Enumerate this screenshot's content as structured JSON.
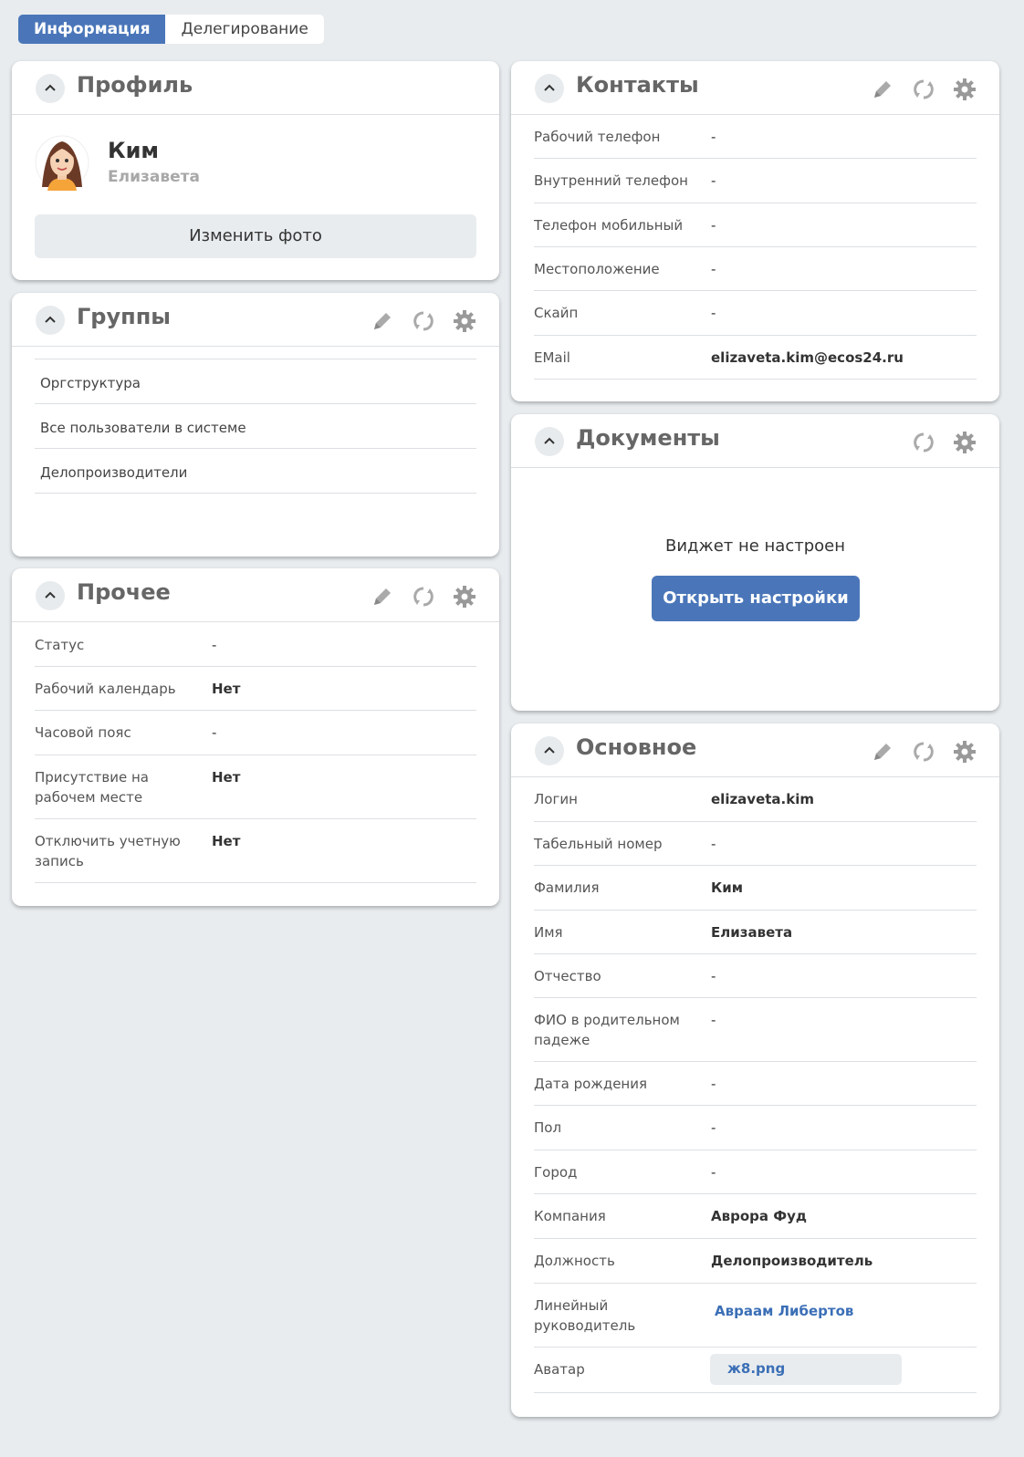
{
  "tabs": {
    "info": "Информация",
    "delegation": "Делегирование"
  },
  "profile": {
    "title": "Профиль",
    "last_name": "Ким",
    "first_name": "Елизавета",
    "change_photo": "Изменить фото"
  },
  "groups": {
    "title": "Группы",
    "items": [
      "Оргструктура",
      "Все пользователи в системе",
      "Делопроизводители"
    ]
  },
  "other": {
    "title": "Прочее",
    "rows": [
      {
        "label": "Статус",
        "value": "-"
      },
      {
        "label": "Рабочий календарь",
        "value": "Нет"
      },
      {
        "label": "Часовой пояс",
        "value": "-"
      },
      {
        "label": "Присутствие на рабочем месте",
        "value": "Нет"
      },
      {
        "label": "Отключить учетную запись",
        "value": "Нет"
      }
    ]
  },
  "contacts": {
    "title": "Контакты",
    "rows": [
      {
        "label": "Рабочий телефон",
        "value": "-"
      },
      {
        "label": "Внутренний телефон",
        "value": "-"
      },
      {
        "label": "Телефон мобильный",
        "value": "-"
      },
      {
        "label": "Местоположение",
        "value": "-"
      },
      {
        "label": "Скайп",
        "value": "-"
      },
      {
        "label": "EMail",
        "value": "elizaveta.kim@ecos24.ru"
      }
    ]
  },
  "documents": {
    "title": "Документы",
    "message": "Виджет не настроен",
    "open_settings": "Открыть настройки"
  },
  "main": {
    "title": "Основное",
    "rows": [
      {
        "label": "Логин",
        "value": "elizaveta.kim"
      },
      {
        "label": "Табельный номер",
        "value": "-"
      },
      {
        "label": "Фамилия",
        "value": "Ким"
      },
      {
        "label": "Имя",
        "value": "Елизавета"
      },
      {
        "label": "Отчество",
        "value": "-"
      },
      {
        "label": "ФИО в родительном падеже",
        "value": "-"
      },
      {
        "label": "Дата рождения",
        "value": "-"
      },
      {
        "label": "Пол",
        "value": "-"
      },
      {
        "label": "Город",
        "value": "-"
      },
      {
        "label": "Компания",
        "value": "Аврора Фуд"
      },
      {
        "label": "Должность",
        "value": "Делопроизводитель"
      },
      {
        "label": "Линейный руководитель",
        "value": "Авраам Либертов"
      },
      {
        "label": "Аватар",
        "value": "ж8.png"
      }
    ]
  },
  "icons": {
    "collapse": "chevron-up-icon",
    "edit": "pencil-icon",
    "reload": "reload-icon",
    "settings": "gear-icon"
  },
  "colors": {
    "accent": "#4a76b9",
    "link": "#3b6fb6",
    "background": "#e8ecef"
  }
}
